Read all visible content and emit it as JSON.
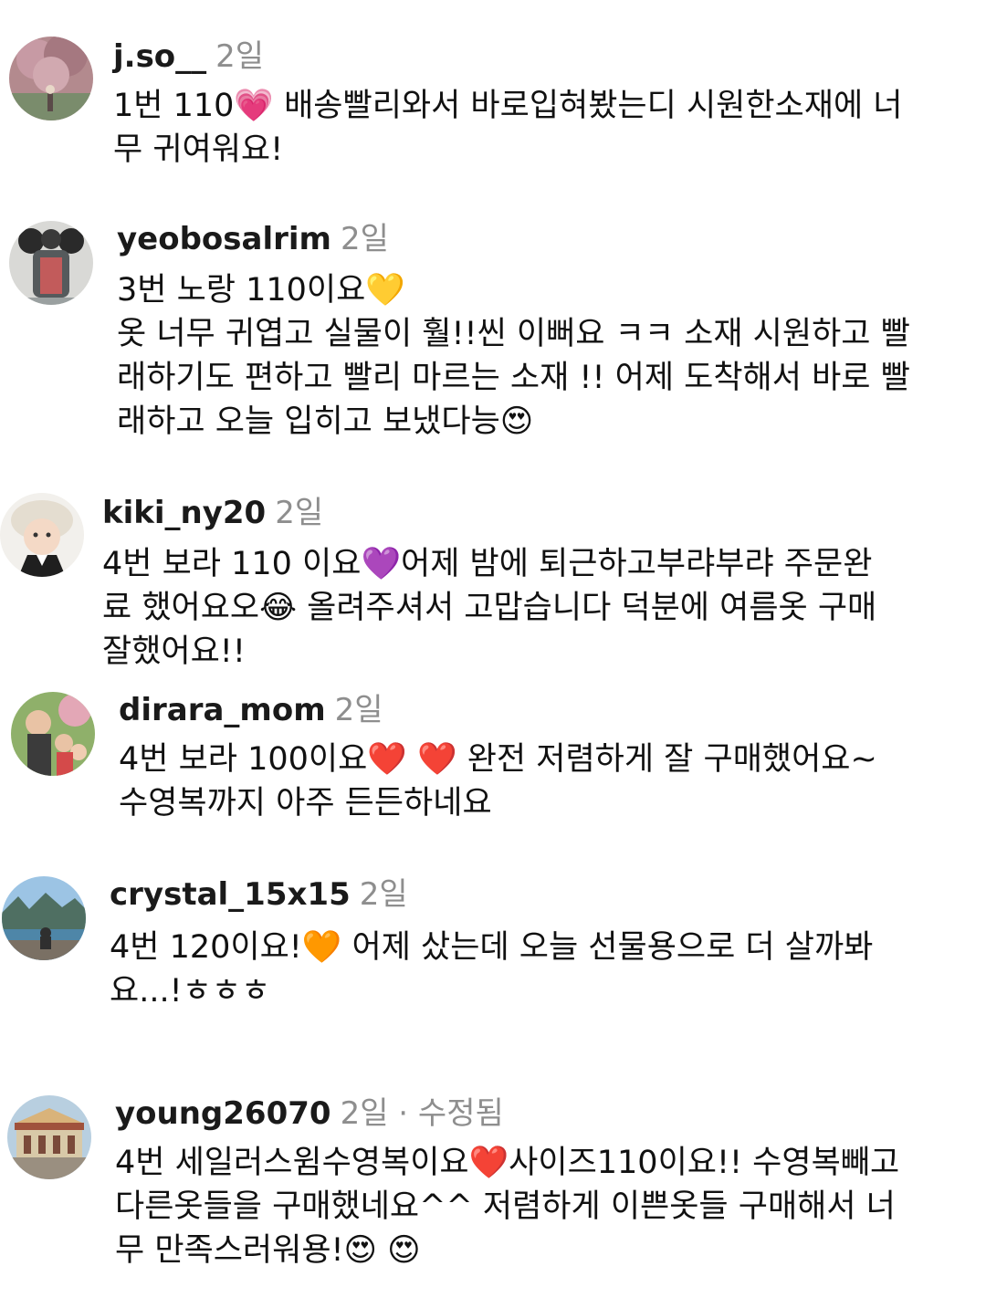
{
  "comments": [
    {
      "user": "j.so__",
      "time": "2일",
      "text": "1번 110💗 배송빨리와서 바로입혀봤는디 시원한소재에 너\n무 귀여워요!"
    },
    {
      "user": "yeobosalrim",
      "time": "2일",
      "text": "3번 노랑 110이요💛\n옷 너무 귀엽고 실물이 훨!!씬 이뻐요 ㅋㅋ 소재 시원하고 빨\n래하기도 편하고 빨리 마르는 소재 !! 어제 도착해서 바로 빨\n래하고 오늘 입히고 보냈다능😍"
    },
    {
      "user": "kiki_ny20",
      "time": "2일",
      "text": "4번 보라 110 이요💜어제 밤에 퇴근하고부랴부랴 주문완\n료 했어요오😂 올려주셔서 고맙습니다 덕분에 여름옷 구매\n잘했어요!!"
    },
    {
      "user": "dirara_mom",
      "time": "2일",
      "text": "4번 보라 100이요❤️ ❤️ 완전 저렴하게 잘 구매했어요~\n수영복까지 아주 든든하네요"
    },
    {
      "user": "crystal_15x15",
      "time": "2일",
      "text": "4번 120이요!🧡 어제 샀는데 오늘 선물용으로 더 살까봐\n요...!ㅎㅎㅎ"
    },
    {
      "user": "young26070",
      "time": "2일",
      "edited": "· 수정됨",
      "text": "4번 세일러스윔수영복이요❤️사이즈110이요!! 수영복빼고\n다른옷들을 구매했네요^^ 저렴하게 이쁜옷들 구매해서 너\n무 만족스러워용!😍 😍"
    }
  ]
}
